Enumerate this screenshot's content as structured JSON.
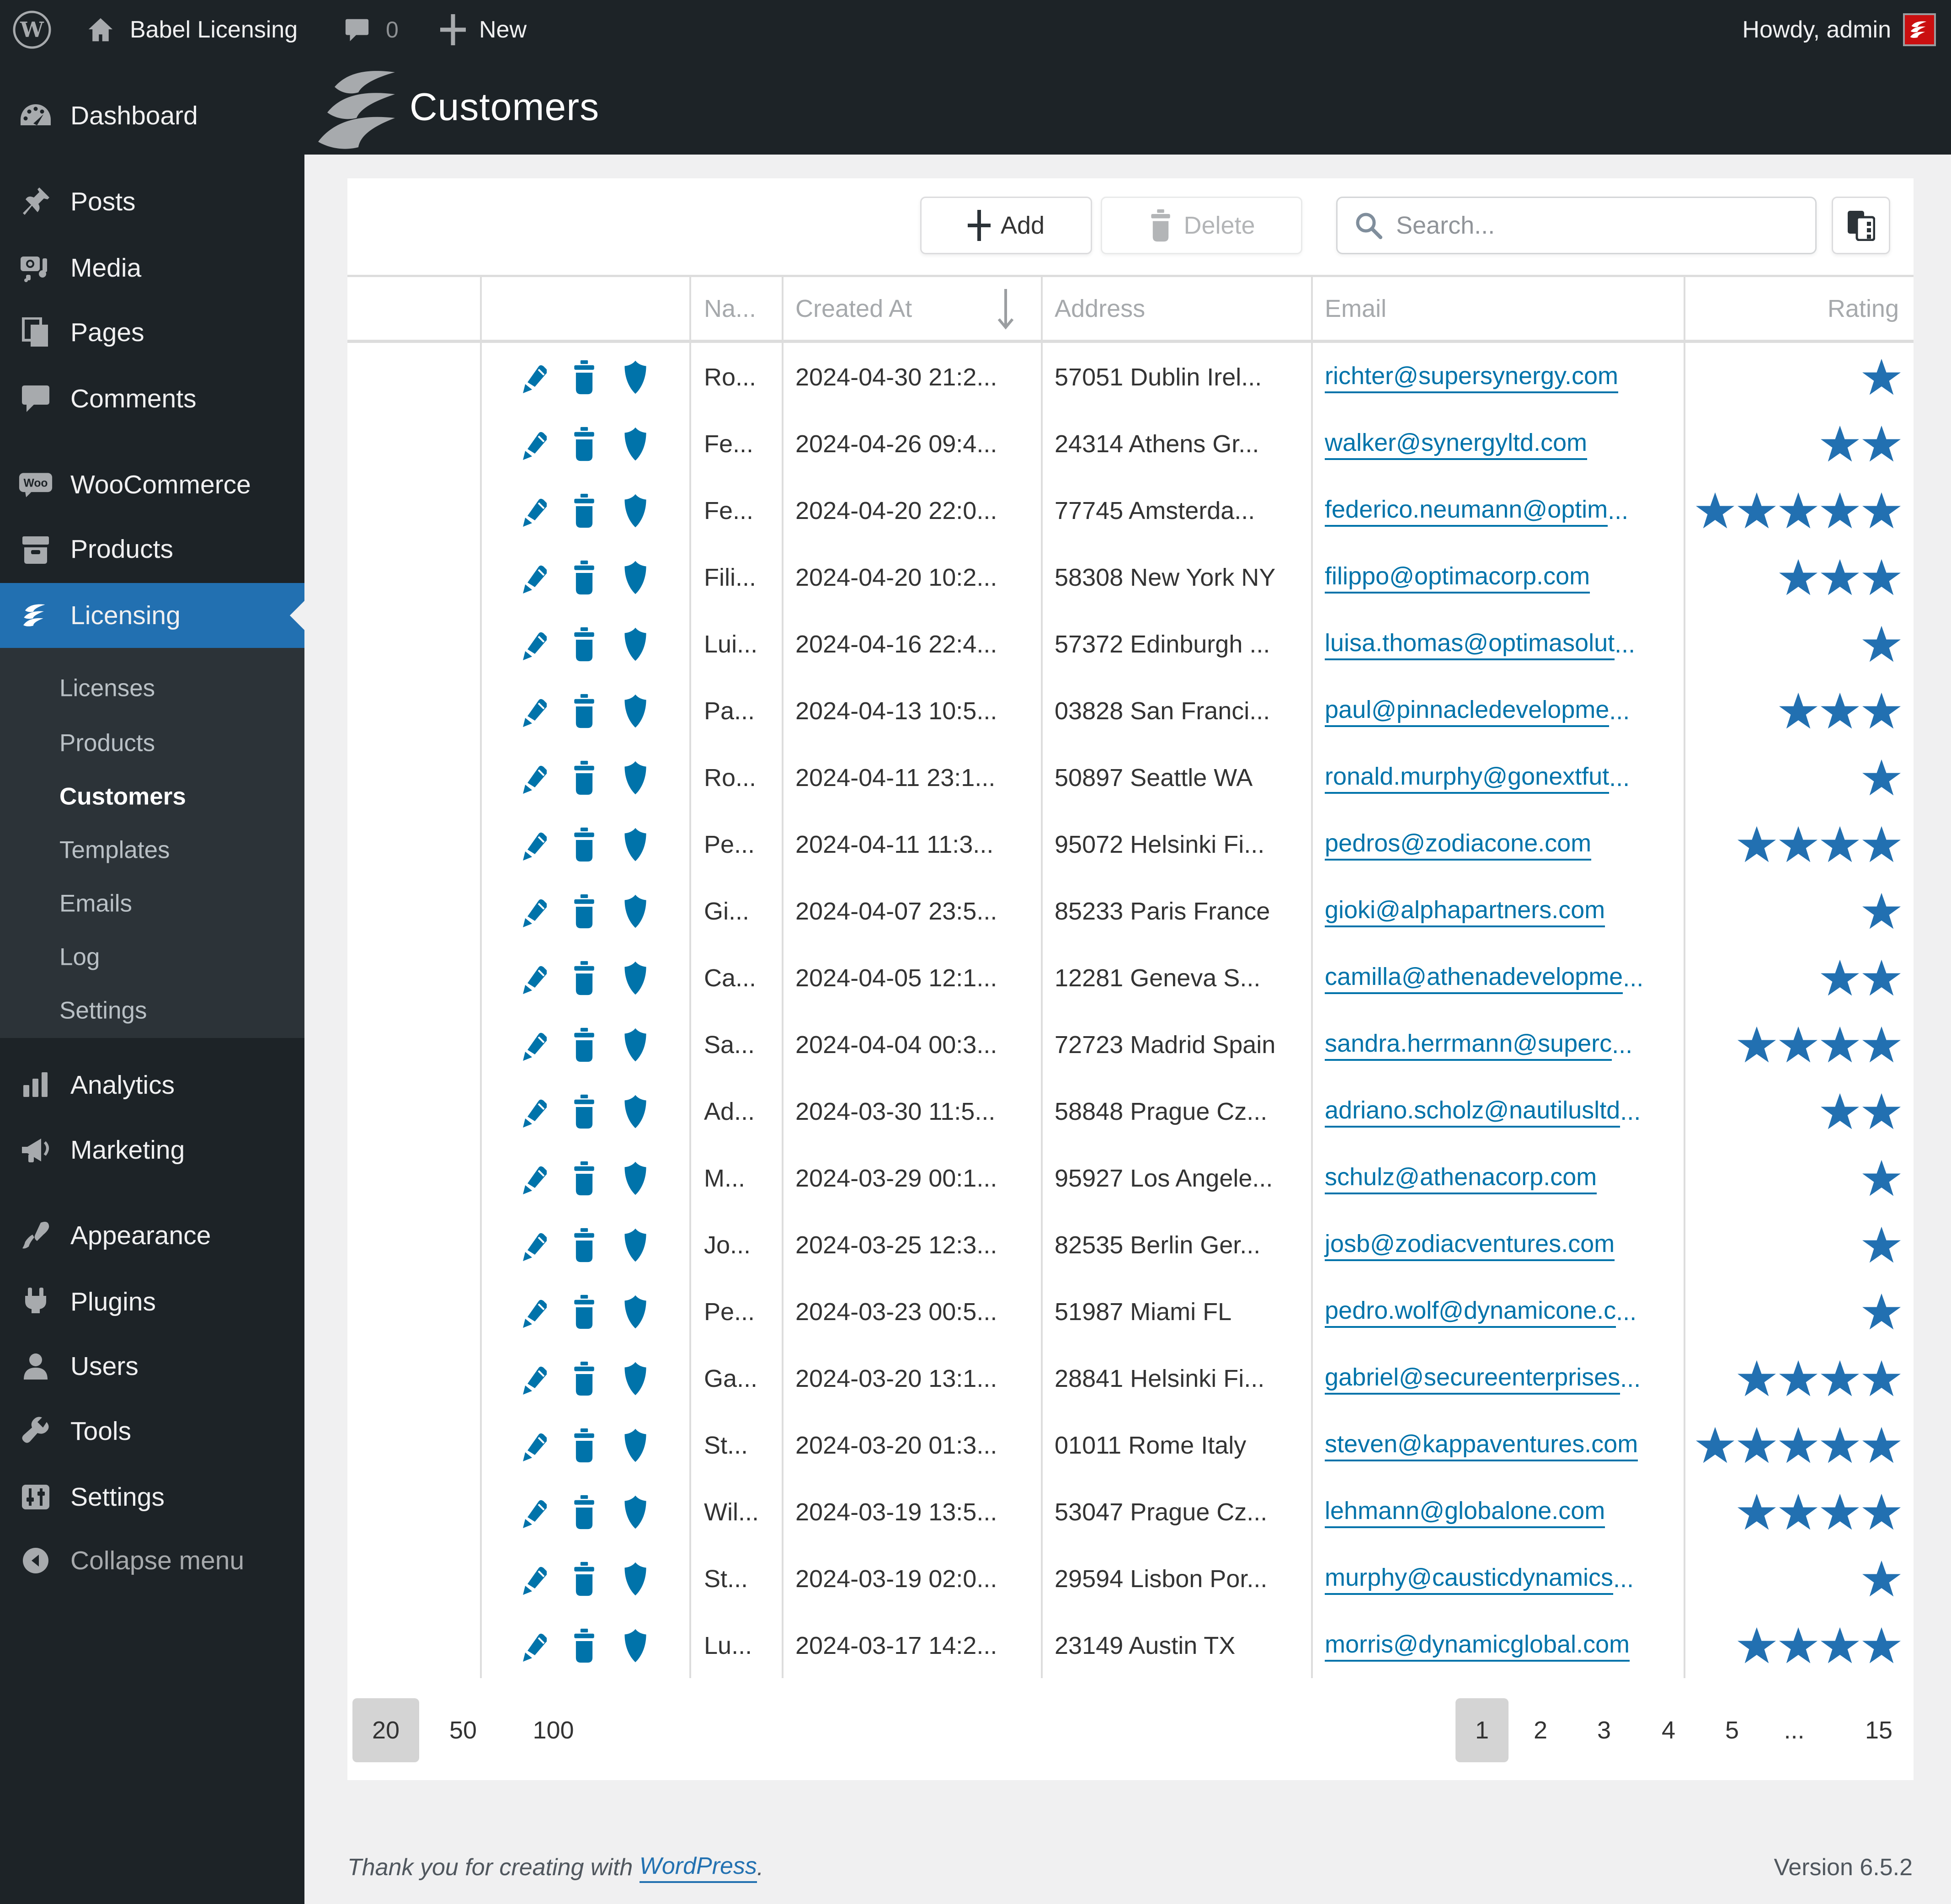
{
  "admin_bar": {
    "site_name": "Babel Licensing",
    "comments_count": "0",
    "new_label": "New",
    "howdy": "Howdy, admin"
  },
  "page": {
    "title": "Customers"
  },
  "toolbar": {
    "add_label": "Add",
    "delete_label": "Delete",
    "search_placeholder": "Search..."
  },
  "sidebar": {
    "main": [
      {
        "label": "Dashboard",
        "icon": "dashboard"
      },
      {
        "label": "Posts",
        "icon": "pin"
      },
      {
        "label": "Media",
        "icon": "media"
      },
      {
        "label": "Pages",
        "icon": "pages"
      },
      {
        "label": "Comments",
        "icon": "comments"
      },
      {
        "label": "WooCommerce",
        "icon": "woocommerce"
      },
      {
        "label": "Products",
        "icon": "products"
      },
      {
        "label": "Licensing",
        "icon": "licensing",
        "active": true
      },
      {
        "label": "Analytics",
        "icon": "analytics"
      },
      {
        "label": "Marketing",
        "icon": "marketing"
      },
      {
        "label": "Appearance",
        "icon": "appearance"
      },
      {
        "label": "Plugins",
        "icon": "plugins"
      },
      {
        "label": "Users",
        "icon": "users"
      },
      {
        "label": "Tools",
        "icon": "tools"
      },
      {
        "label": "Settings",
        "icon": "settings"
      },
      {
        "label": "Collapse menu",
        "icon": "collapse"
      }
    ],
    "licensing_submenu": [
      {
        "label": "Licenses"
      },
      {
        "label": "Products"
      },
      {
        "label": "Customers",
        "current": true
      },
      {
        "label": "Templates"
      },
      {
        "label": "Emails"
      },
      {
        "label": "Log"
      },
      {
        "label": "Settings"
      }
    ]
  },
  "table": {
    "columns": [
      "",
      "",
      "Na...",
      "Created At",
      "Address",
      "Email",
      "Rating"
    ],
    "rows": [
      {
        "name": "Ro...",
        "created_at": "2024-04-30 21:2...",
        "address": "57051 Dublin Irel...",
        "email": "richter@supersynergy.com",
        "rating": 1
      },
      {
        "name": "Fe...",
        "created_at": "2024-04-26 09:4...",
        "address": "24314 Athens Gr...",
        "email": "walker@synergyltd.com",
        "rating": 2
      },
      {
        "name": "Fe...",
        "created_at": "2024-04-20 22:0...",
        "address": "77745 Amsterda...",
        "email": "federico.neumann@optim...",
        "rating": 5
      },
      {
        "name": "Fili...",
        "created_at": "2024-04-20 10:2...",
        "address": "58308 New York NY",
        "email": "filippo@optimacorp.com",
        "rating": 3
      },
      {
        "name": "Lui...",
        "created_at": "2024-04-16 22:4...",
        "address": "57372 Edinburgh ...",
        "email": "luisa.thomas@optimasolut...",
        "rating": 1
      },
      {
        "name": "Pa...",
        "created_at": "2024-04-13 10:5...",
        "address": "03828 San Franci...",
        "email": "paul@pinnacledevelopme...",
        "rating": 3
      },
      {
        "name": "Ro...",
        "created_at": "2024-04-11 23:1...",
        "address": "50897 Seattle WA",
        "email": "ronald.murphy@gonextfut...",
        "rating": 1
      },
      {
        "name": "Pe...",
        "created_at": "2024-04-11 11:3...",
        "address": "95072 Helsinki Fi...",
        "email": "pedros@zodiacone.com",
        "rating": 4
      },
      {
        "name": "Gi...",
        "created_at": "2024-04-07 23:5...",
        "address": "85233 Paris France",
        "email": "gioki@alphapartners.com",
        "rating": 1
      },
      {
        "name": "Ca...",
        "created_at": "2024-04-05 12:1...",
        "address": "12281 Geneva S...",
        "email": "camilla@athenadevelopme...",
        "rating": 2
      },
      {
        "name": "Sa...",
        "created_at": "2024-04-04 00:3...",
        "address": "72723 Madrid Spain",
        "email": "sandra.herrmann@superc...",
        "rating": 4
      },
      {
        "name": "Ad...",
        "created_at": "2024-03-30 11:5...",
        "address": "58848 Prague Cz...",
        "email": "adriano.scholz@nautilusltd...",
        "rating": 2
      },
      {
        "name": "M...",
        "created_at": "2024-03-29 00:1...",
        "address": "95927 Los Angele...",
        "email": "schulz@athenacorp.com",
        "rating": 1
      },
      {
        "name": "Jo...",
        "created_at": "2024-03-25 12:3...",
        "address": "82535 Berlin Ger...",
        "email": "josb@zodiacventures.com",
        "rating": 1
      },
      {
        "name": "Pe...",
        "created_at": "2024-03-23 00:5...",
        "address": "51987 Miami FL",
        "email": "pedro.wolf@dynamicone.c...",
        "rating": 1
      },
      {
        "name": "Ga...",
        "created_at": "2024-03-20 13:1...",
        "address": "28841 Helsinki Fi...",
        "email": "gabriel@secureenterprises...",
        "rating": 4
      },
      {
        "name": "St...",
        "created_at": "2024-03-20 01:3...",
        "address": "01011 Rome Italy",
        "email": "steven@kappaventures.com",
        "rating": 5
      },
      {
        "name": "Wil...",
        "created_at": "2024-03-19 13:5...",
        "address": "53047 Prague Cz...",
        "email": "lehmann@globalone.com",
        "rating": 4
      },
      {
        "name": "St...",
        "created_at": "2024-03-19 02:0...",
        "address": "29594 Lisbon Por...",
        "email": "murphy@causticdynamics...",
        "rating": 1
      },
      {
        "name": "Lu...",
        "created_at": "2024-03-17 14:2...",
        "address": "23149 Austin TX",
        "email": "morris@dynamicglobal.com",
        "rating": 4
      }
    ]
  },
  "pagination": {
    "page_sizes": [
      {
        "label": "20",
        "current": true
      },
      {
        "label": "50"
      },
      {
        "label": "100"
      }
    ],
    "pages": [
      {
        "label": "1",
        "current": true
      },
      {
        "label": "2"
      },
      {
        "label": "3"
      },
      {
        "label": "4"
      },
      {
        "label": "5"
      },
      {
        "label": "..."
      },
      {
        "label": "15"
      }
    ]
  },
  "footer": {
    "thanks_prefix": "Thank you for creating with ",
    "wordpress_link": "WordPress",
    "thanks_suffix": ".",
    "version": "Version 6.5.2"
  },
  "colors": {
    "admin_dark": "#1d2327",
    "submenu_bg": "#2c3338",
    "accent_blue": "#2271b1",
    "link_blue": "#0073aa",
    "star_blue": "#2270b1",
    "avatar_red": "#ca0f10",
    "content_bg": "#f0f0f1",
    "table_line": "#dddddd",
    "text_dark": "#333333",
    "header_text": "#a6a9ac"
  }
}
